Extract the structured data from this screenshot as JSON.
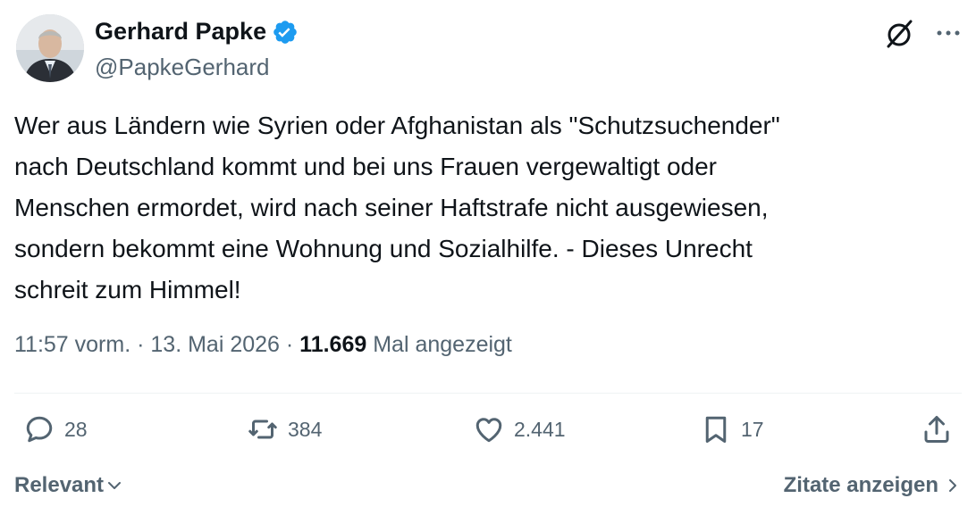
{
  "author": {
    "name": "Gerhard Papke",
    "handle": "@PapkeGerhard",
    "verified": true,
    "verified_color": "#1d9bf0"
  },
  "tweet": {
    "text": "Wer aus Ländern wie Syrien oder Afghanistan als \"Schutzsuchender\"\nnach Deutschland kommt und bei uns Frauen vergewaltigt oder\nMenschen ermordet, wird nach seiner Haftstrafe nicht ausgewiesen,\nsondern bekommt eine Wohnung und Sozialhilfe. - Dieses Unrecht\nschreit zum Himmel!",
    "time": "11:57 vorm.",
    "separator": "·",
    "date": "13. Mai 2026",
    "views_count": "11.669",
    "views_label": "Mal angezeigt"
  },
  "actions": {
    "replies": "28",
    "retweets": "384",
    "likes": "2.441",
    "bookmarks": "17"
  },
  "footer": {
    "sort_label": "Relevant",
    "quotes_label": "Zitate anzeigen"
  },
  "icons": {
    "grok": "grok-icon",
    "more": "more-icon",
    "reply": "reply-icon",
    "retweet": "retweet-icon",
    "like": "heart-icon",
    "bookmark": "bookmark-icon",
    "share": "share-icon"
  }
}
